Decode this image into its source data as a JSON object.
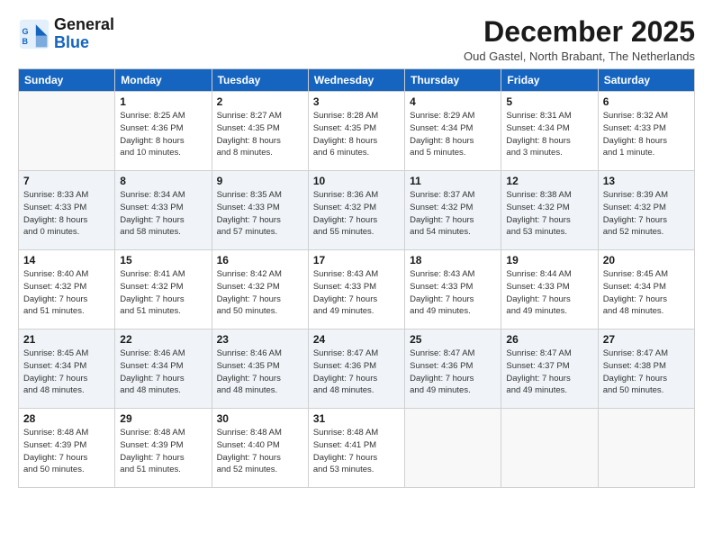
{
  "logo": {
    "line1": "General",
    "line2": "Blue"
  },
  "title": "December 2025",
  "subtitle": "Oud Gastel, North Brabant, The Netherlands",
  "days_of_week": [
    "Sunday",
    "Monday",
    "Tuesday",
    "Wednesday",
    "Thursday",
    "Friday",
    "Saturday"
  ],
  "weeks": [
    [
      {
        "num": "",
        "detail": ""
      },
      {
        "num": "1",
        "detail": "Sunrise: 8:25 AM\nSunset: 4:36 PM\nDaylight: 8 hours\nand 10 minutes."
      },
      {
        "num": "2",
        "detail": "Sunrise: 8:27 AM\nSunset: 4:35 PM\nDaylight: 8 hours\nand 8 minutes."
      },
      {
        "num": "3",
        "detail": "Sunrise: 8:28 AM\nSunset: 4:35 PM\nDaylight: 8 hours\nand 6 minutes."
      },
      {
        "num": "4",
        "detail": "Sunrise: 8:29 AM\nSunset: 4:34 PM\nDaylight: 8 hours\nand 5 minutes."
      },
      {
        "num": "5",
        "detail": "Sunrise: 8:31 AM\nSunset: 4:34 PM\nDaylight: 8 hours\nand 3 minutes."
      },
      {
        "num": "6",
        "detail": "Sunrise: 8:32 AM\nSunset: 4:33 PM\nDaylight: 8 hours\nand 1 minute."
      }
    ],
    [
      {
        "num": "7",
        "detail": "Sunrise: 8:33 AM\nSunset: 4:33 PM\nDaylight: 8 hours\nand 0 minutes."
      },
      {
        "num": "8",
        "detail": "Sunrise: 8:34 AM\nSunset: 4:33 PM\nDaylight: 7 hours\nand 58 minutes."
      },
      {
        "num": "9",
        "detail": "Sunrise: 8:35 AM\nSunset: 4:33 PM\nDaylight: 7 hours\nand 57 minutes."
      },
      {
        "num": "10",
        "detail": "Sunrise: 8:36 AM\nSunset: 4:32 PM\nDaylight: 7 hours\nand 55 minutes."
      },
      {
        "num": "11",
        "detail": "Sunrise: 8:37 AM\nSunset: 4:32 PM\nDaylight: 7 hours\nand 54 minutes."
      },
      {
        "num": "12",
        "detail": "Sunrise: 8:38 AM\nSunset: 4:32 PM\nDaylight: 7 hours\nand 53 minutes."
      },
      {
        "num": "13",
        "detail": "Sunrise: 8:39 AM\nSunset: 4:32 PM\nDaylight: 7 hours\nand 52 minutes."
      }
    ],
    [
      {
        "num": "14",
        "detail": "Sunrise: 8:40 AM\nSunset: 4:32 PM\nDaylight: 7 hours\nand 51 minutes."
      },
      {
        "num": "15",
        "detail": "Sunrise: 8:41 AM\nSunset: 4:32 PM\nDaylight: 7 hours\nand 51 minutes."
      },
      {
        "num": "16",
        "detail": "Sunrise: 8:42 AM\nSunset: 4:32 PM\nDaylight: 7 hours\nand 50 minutes."
      },
      {
        "num": "17",
        "detail": "Sunrise: 8:43 AM\nSunset: 4:33 PM\nDaylight: 7 hours\nand 49 minutes."
      },
      {
        "num": "18",
        "detail": "Sunrise: 8:43 AM\nSunset: 4:33 PM\nDaylight: 7 hours\nand 49 minutes."
      },
      {
        "num": "19",
        "detail": "Sunrise: 8:44 AM\nSunset: 4:33 PM\nDaylight: 7 hours\nand 49 minutes."
      },
      {
        "num": "20",
        "detail": "Sunrise: 8:45 AM\nSunset: 4:34 PM\nDaylight: 7 hours\nand 48 minutes."
      }
    ],
    [
      {
        "num": "21",
        "detail": "Sunrise: 8:45 AM\nSunset: 4:34 PM\nDaylight: 7 hours\nand 48 minutes."
      },
      {
        "num": "22",
        "detail": "Sunrise: 8:46 AM\nSunset: 4:34 PM\nDaylight: 7 hours\nand 48 minutes."
      },
      {
        "num": "23",
        "detail": "Sunrise: 8:46 AM\nSunset: 4:35 PM\nDaylight: 7 hours\nand 48 minutes."
      },
      {
        "num": "24",
        "detail": "Sunrise: 8:47 AM\nSunset: 4:36 PM\nDaylight: 7 hours\nand 48 minutes."
      },
      {
        "num": "25",
        "detail": "Sunrise: 8:47 AM\nSunset: 4:36 PM\nDaylight: 7 hours\nand 49 minutes."
      },
      {
        "num": "26",
        "detail": "Sunrise: 8:47 AM\nSunset: 4:37 PM\nDaylight: 7 hours\nand 49 minutes."
      },
      {
        "num": "27",
        "detail": "Sunrise: 8:47 AM\nSunset: 4:38 PM\nDaylight: 7 hours\nand 50 minutes."
      }
    ],
    [
      {
        "num": "28",
        "detail": "Sunrise: 8:48 AM\nSunset: 4:39 PM\nDaylight: 7 hours\nand 50 minutes."
      },
      {
        "num": "29",
        "detail": "Sunrise: 8:48 AM\nSunset: 4:39 PM\nDaylight: 7 hours\nand 51 minutes."
      },
      {
        "num": "30",
        "detail": "Sunrise: 8:48 AM\nSunset: 4:40 PM\nDaylight: 7 hours\nand 52 minutes."
      },
      {
        "num": "31",
        "detail": "Sunrise: 8:48 AM\nSunset: 4:41 PM\nDaylight: 7 hours\nand 53 minutes."
      },
      {
        "num": "",
        "detail": ""
      },
      {
        "num": "",
        "detail": ""
      },
      {
        "num": "",
        "detail": ""
      }
    ]
  ]
}
